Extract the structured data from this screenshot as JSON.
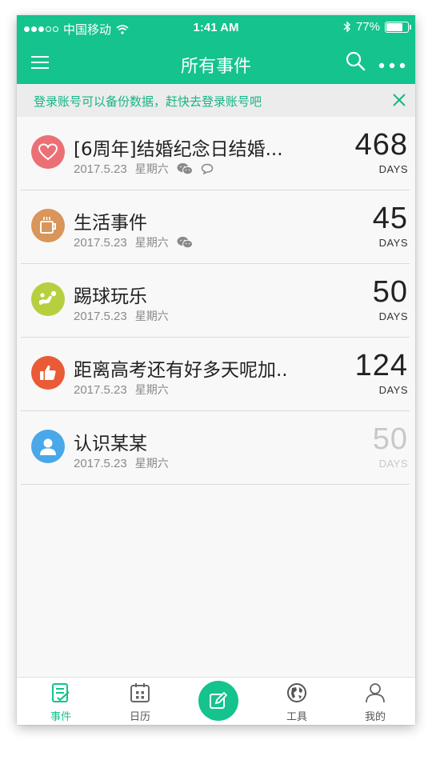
{
  "status": {
    "carrier": "中国移动",
    "time": "1:41 AM",
    "battery": "77%",
    "signal_bars": 3,
    "battery_level": 0.77
  },
  "nav": {
    "title": "所有事件",
    "menu_icon": "hamburger-icon",
    "search_icon": "search-icon",
    "more_icon": "more-icon"
  },
  "banner": {
    "text": "登录账号可以备份数据，赶快去登录账号吧",
    "close_icon": "close-icon"
  },
  "colors": {
    "brand": "#14c38e",
    "heart": "#ec6f75",
    "coffee": "#d9955a",
    "soccer": "#b6cf3e",
    "thumb": "#ea5a36",
    "person": "#4aa8e8"
  },
  "events": [
    {
      "title": "[6周年]结婚纪念日结婚...",
      "date": "2017.5.23",
      "weekday": "星期六",
      "days": "468",
      "days_label": "DAYS",
      "icon": "heart-icon",
      "badges": [
        "wechat-icon",
        "comment-icon"
      ]
    },
    {
      "title": "生活事件",
      "date": "2017.5.23",
      "weekday": "星期六",
      "days": "45",
      "days_label": "DAYS",
      "icon": "coffee-cup-icon",
      "badges": [
        "wechat-icon"
      ]
    },
    {
      "title": "踢球玩乐",
      "date": "2017.5.23",
      "weekday": "星期六",
      "days": "50",
      "days_label": "DAYS",
      "icon": "soccer-icon",
      "badges": []
    },
    {
      "title": "距离高考还有好多天呢加..",
      "date": "2017.5.23",
      "weekday": "星期六",
      "days": "124",
      "days_label": "DAYS",
      "icon": "thumbs-up-icon",
      "badges": []
    },
    {
      "title": "认识某某",
      "date": "2017.5.23",
      "weekday": "星期六",
      "days": "50",
      "days_label": "DAYS",
      "icon": "person-icon",
      "badges": []
    }
  ],
  "tabs": [
    {
      "label": "事件",
      "icon": "event-list-icon",
      "active": true
    },
    {
      "label": "日历",
      "icon": "calendar-icon",
      "active": false
    },
    {
      "label": "",
      "icon": "edit-icon",
      "active": false
    },
    {
      "label": "工具",
      "icon": "globe-icon",
      "active": false
    },
    {
      "label": "我的",
      "icon": "user-icon",
      "active": false
    }
  ]
}
